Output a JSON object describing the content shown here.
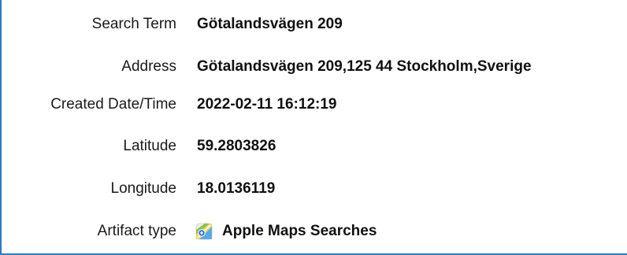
{
  "fields": {
    "search_term": {
      "label": "Search Term",
      "value": "Götalandsvägen 209"
    },
    "address": {
      "label": "Address",
      "value": "Götalandsvägen 209,125 44 Stockholm,Sverige"
    },
    "created": {
      "label": "Created Date/Time",
      "value": "2022-02-11 16:12:19"
    },
    "latitude": {
      "label": "Latitude",
      "value": "59.2803826"
    },
    "longitude": {
      "label": "Longitude",
      "value": "18.0136119"
    },
    "artifact_type": {
      "label": "Artifact type",
      "value": "Apple Maps Searches",
      "icon": "apple-maps-icon"
    }
  },
  "colors": {
    "border": "#2b7bbf",
    "text": "#1a1a1a"
  }
}
